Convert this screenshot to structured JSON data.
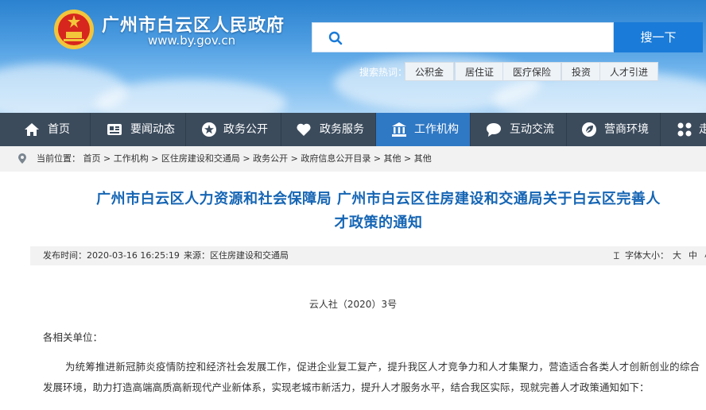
{
  "header": {
    "site_title": "广州市白云区人民政府",
    "site_url": "www.by.gov.cn",
    "search": {
      "placeholder": "",
      "button_label": "搜一下"
    },
    "hot_search_label": "搜索热词：",
    "hot_tags": [
      "公积金",
      "居住证",
      "医疗保险",
      "投资",
      "人才引进"
    ]
  },
  "nav": {
    "items": [
      {
        "label": "首页",
        "icon": "home-icon"
      },
      {
        "label": "要闻动态",
        "icon": "news-icon"
      },
      {
        "label": "政务公开",
        "icon": "star-icon"
      },
      {
        "label": "政务服务",
        "icon": "heart-icon"
      },
      {
        "label": "工作机构",
        "icon": "building-icon",
        "active": true
      },
      {
        "label": "互动交流",
        "icon": "chat-icon"
      },
      {
        "label": "营商环境",
        "icon": "leaf-icon"
      },
      {
        "label": "走",
        "icon": "grid-icon"
      }
    ],
    "active_color": "#2f78c4",
    "bar_color": "#3b4b5c"
  },
  "breadcrumb": {
    "text": "当前位置： 首页 > 工作机构 > 区住房建设和交通局 > 政务公开 > 政府信息公开目录 > 其他 > 其他"
  },
  "article": {
    "title_line1": "广州市白云区人力资源和社会保障局 广州市白云区住房建设和交通局关于白云区完善人",
    "title_line2": "才政策的通知",
    "publish_time": "发布时间：2020-03-16 16:25:19",
    "source": "来源：区住房建设和交通局",
    "font_size_label": "字体大小：",
    "font_size_options": [
      "大",
      "中",
      "小"
    ],
    "doc_number": "云人社（2020）3号",
    "salutation": "各相关单位：",
    "paragraph": "为统筹推进新冠肺炎疫情防控和经济社会发展工作，促进企业复工复产，提升我区人才竞争力和人才集聚力，营造适合各类人才创新创业的综合发展环境，助力打造高端高质高新现代产业新体系，实现老城市新活力，提升人才服务水平，结合我区实际，现就完善人才政策通知如下：",
    "title_color": "#1565b4"
  }
}
